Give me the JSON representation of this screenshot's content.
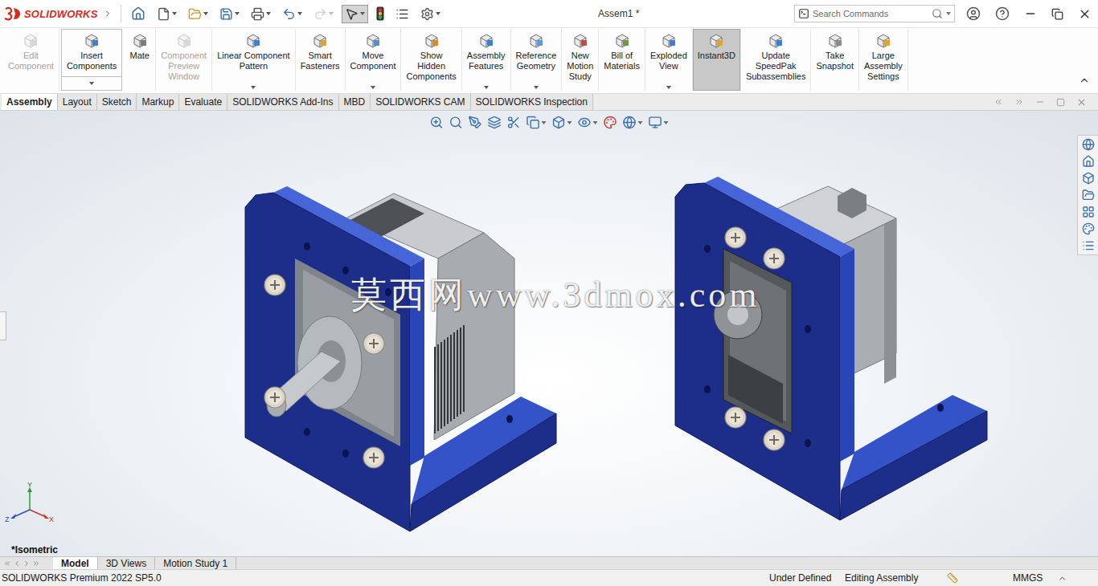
{
  "app": {
    "name": "SOLIDWORKS"
  },
  "window": {
    "title": "Assem1 *"
  },
  "quick_access": {
    "select_pressed": true,
    "redo_disabled": true
  },
  "search": {
    "placeholder": "Search Commands"
  },
  "ribbon": [
    {
      "lines": [
        "Edit",
        "Component"
      ],
      "kind": "button",
      "disabled": true,
      "selected": false
    },
    {
      "lines": [
        "Insert",
        "Components"
      ],
      "kind": "split",
      "disabled": false,
      "selected": false
    },
    {
      "lines": [
        "Mate"
      ],
      "kind": "button",
      "disabled": false,
      "selected": false
    },
    {
      "lines": [
        "Component",
        "Preview",
        "Window"
      ],
      "kind": "button",
      "disabled": true,
      "selected": false
    },
    {
      "lines": [
        "Linear Component",
        "Pattern"
      ],
      "kind": "dropdown",
      "disabled": false,
      "selected": false
    },
    {
      "lines": [
        "Smart",
        "Fasteners"
      ],
      "kind": "button",
      "disabled": false,
      "selected": false
    },
    {
      "lines": [
        "Move",
        "Component"
      ],
      "kind": "dropdown",
      "disabled": false,
      "selected": false
    },
    {
      "lines": [
        "Show",
        "Hidden",
        "Components"
      ],
      "kind": "button",
      "disabled": false,
      "selected": false
    },
    {
      "lines": [
        "Assembly",
        "Features"
      ],
      "kind": "dropdown",
      "disabled": false,
      "selected": false
    },
    {
      "lines": [
        "Reference",
        "Geometry"
      ],
      "kind": "dropdown",
      "disabled": false,
      "selected": false
    },
    {
      "lines": [
        "New",
        "Motion",
        "Study"
      ],
      "kind": "button",
      "disabled": false,
      "selected": false
    },
    {
      "lines": [
        "Bill of",
        "Materials"
      ],
      "kind": "button",
      "disabled": false,
      "selected": false
    },
    {
      "lines": [
        "Exploded",
        "View"
      ],
      "kind": "dropdown",
      "disabled": false,
      "selected": false
    },
    {
      "lines": [
        "Instant3D"
      ],
      "kind": "button",
      "disabled": false,
      "selected": true
    },
    {
      "lines": [
        "Update",
        "SpeedPak",
        "Subassemblies"
      ],
      "kind": "button",
      "disabled": false,
      "selected": false
    },
    {
      "lines": [
        "Take",
        "Snapshot"
      ],
      "kind": "button",
      "disabled": false,
      "selected": false
    },
    {
      "lines": [
        "Large",
        "Assembly",
        "Settings"
      ],
      "kind": "button",
      "disabled": false,
      "selected": false
    }
  ],
  "tabs": [
    {
      "label": "Assembly",
      "selected": true
    },
    {
      "label": "Layout",
      "selected": false
    },
    {
      "label": "Sketch",
      "selected": false
    },
    {
      "label": "Markup",
      "selected": false
    },
    {
      "label": "Evaluate",
      "selected": false
    },
    {
      "label": "SOLIDWORKS Add-Ins",
      "selected": false
    },
    {
      "label": "MBD",
      "selected": false
    },
    {
      "label": "SOLIDWORKS CAM",
      "selected": false
    },
    {
      "label": "SOLIDWORKS Inspection",
      "selected": false
    }
  ],
  "viewport": {
    "watermark": "莫西网www.3dmox.com",
    "view_label": "*Isometric",
    "axes": {
      "y": "Y",
      "z": "Z",
      "x": "X"
    }
  },
  "bottom_tabs": [
    {
      "label": "Model",
      "selected": true
    },
    {
      "label": "3D Views",
      "selected": false
    },
    {
      "label": "Motion Study 1",
      "selected": false
    }
  ],
  "status_bar": {
    "product": "SOLIDWORKS Premium 2022 SP5.0",
    "state": "Under Defined",
    "mode": "Editing Assembly",
    "units": "MMGS"
  }
}
